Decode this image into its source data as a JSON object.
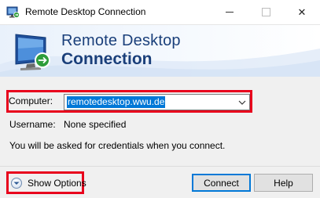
{
  "window": {
    "title": "Remote Desktop Connection",
    "icons": {
      "app": "remote-desktop-app-icon",
      "minimize": "minimize-icon",
      "maximize": "maximize-icon",
      "close": "close-icon"
    },
    "close_glyph": "✕"
  },
  "banner": {
    "line1": "Remote Desktop",
    "line2": "Connection",
    "logo_icon": "remote-desktop-monitor-icon"
  },
  "form": {
    "computer_label": "Computer:",
    "computer_value": "remotedesktop.wwu.de",
    "username_label": "Username:",
    "username_value": "None specified",
    "credentials_note": "You will be asked for credentials when you connect."
  },
  "footer": {
    "show_options_label": "Show Options",
    "connect_label": "Connect",
    "help_label": "Help"
  },
  "colors": {
    "highlight_border": "#e8001c",
    "selection": "#0078d7",
    "banner_text": "#1a3f7a"
  }
}
